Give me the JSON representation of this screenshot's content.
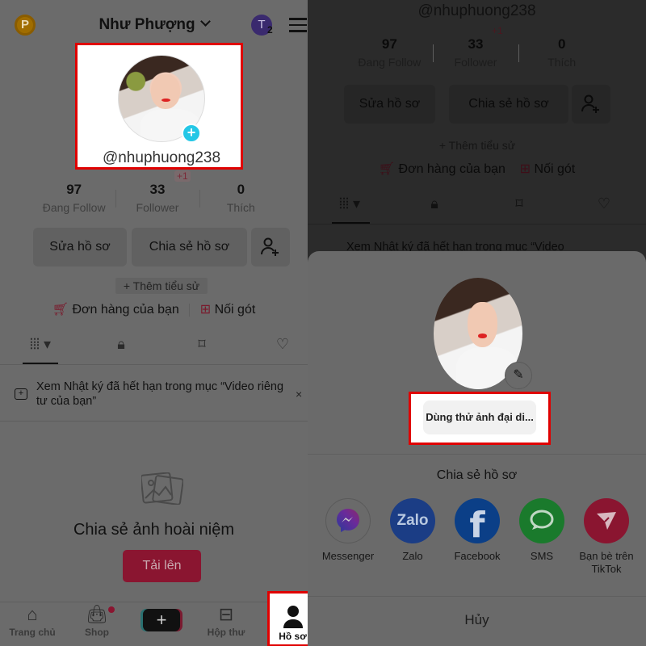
{
  "left": {
    "header": {
      "coin_label": "P",
      "profile_name": "Như Phượng",
      "account_initial": "T",
      "account_count": "2"
    },
    "profile": {
      "handle": "@nhuphuong238",
      "add_avatar_label": "+"
    },
    "stats": [
      {
        "value": "97",
        "label": "Đang Follow"
      },
      {
        "value": "33",
        "label": "Follower"
      },
      {
        "value": "0",
        "label": "Thích"
      }
    ],
    "follower_delta": "+1",
    "buttons": {
      "edit_profile": "Sửa hồ sơ",
      "share_profile": "Chia sẻ hồ sơ"
    },
    "add_bio": "+ Thêm tiểu sử",
    "links": {
      "orders": "Đơn hàng của bạn",
      "noi_got": "Nối gót"
    },
    "tabs": [
      {
        "name": "videos",
        "icon": "grid-icon",
        "active": true
      },
      {
        "name": "private",
        "icon": "lock-icon"
      },
      {
        "name": "saved",
        "icon": "bookmark-icon"
      },
      {
        "name": "liked",
        "icon": "heart-icon"
      }
    ],
    "notice": {
      "text": "Xem Nhật ký đã hết hạn trong mục “Video riêng tư của bạn”",
      "close": "×"
    },
    "empty_state": {
      "title": "Chia sẻ ảnh hoài niệm",
      "upload_button": "Tải lên"
    },
    "bottom_nav": [
      {
        "label": "Trang chủ",
        "icon": "home-icon"
      },
      {
        "label": "Shop",
        "icon": "shop-icon",
        "badge": true
      },
      {
        "label": "",
        "icon": "create-icon"
      },
      {
        "label": "Hộp thư",
        "icon": "inbox-icon"
      },
      {
        "label": "Hồ sơ",
        "icon": "profile-icon",
        "active": true
      }
    ]
  },
  "right": {
    "handle": "@nhuphuong238",
    "stats": [
      {
        "value": "97",
        "label": "Đang Follow"
      },
      {
        "value": "33",
        "label": "Follower"
      },
      {
        "value": "0",
        "label": "Thích"
      }
    ],
    "follower_delta": "+1",
    "buttons": {
      "edit_profile": "Sửa hồ sơ",
      "share_profile": "Chia sẻ hồ sơ"
    },
    "add_bio": "+ Thêm tiểu sử",
    "links": {
      "orders": "Đơn hàng của bạn",
      "noi_got": "Nối gót"
    },
    "notice_text": "Xem Nhật ký đã hết hạn trong mục “Video",
    "sheet": {
      "try_avatar_button": "Dùng thử ảnh đại di...",
      "share_title": "Chia sẻ hồ sơ",
      "share_targets": [
        {
          "label": "Messenger",
          "icon": "messenger-icon",
          "color": "#5a2a8a"
        },
        {
          "label": "Zalo",
          "icon": "zalo-icon",
          "color": "#1b3d85",
          "glyph": "Zalo"
        },
        {
          "label": "Facebook",
          "icon": "facebook-icon",
          "color": "#0b3f87",
          "glyph": "f"
        },
        {
          "label": "SMS",
          "icon": "sms-icon",
          "color": "#1a7a2c"
        },
        {
          "label": "Bạn bè trên TikTok",
          "icon": "tiktok-friends-icon",
          "color": "#8a1530"
        }
      ],
      "cancel": "Hủy"
    }
  },
  "colors": {
    "highlight": "#e00000",
    "accent_cyan": "#24c7e6",
    "tiktok_red": "#8a1530"
  }
}
